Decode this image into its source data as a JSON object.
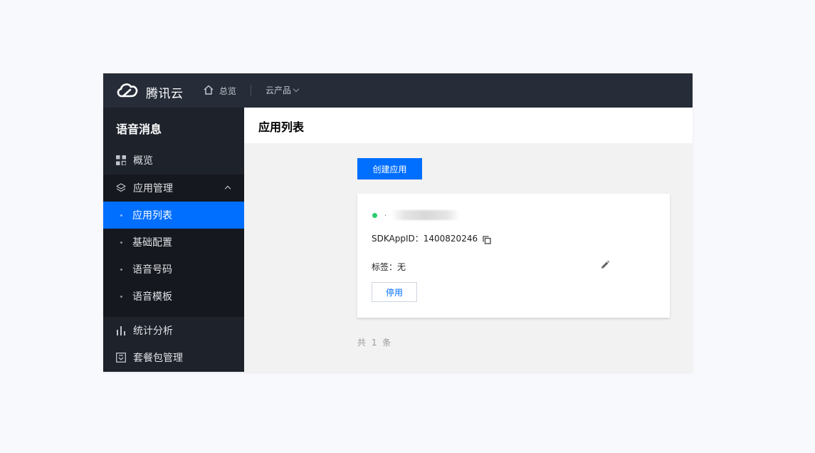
{
  "topbar": {
    "brand": "腾讯云",
    "overview": "总览",
    "products": "云产品"
  },
  "sidebar": {
    "title": "语音消息",
    "items": [
      {
        "label": "概览",
        "icon": "grid-icon"
      },
      {
        "label": "应用管理",
        "icon": "layers-icon",
        "expanded": true,
        "children": [
          "应用列表",
          "基础配置",
          "语音号码",
          "语音模板"
        ],
        "active_child": "应用列表"
      },
      {
        "label": "统计分析",
        "icon": "bar-chart-icon"
      },
      {
        "label": "套餐包管理",
        "icon": "package-icon"
      }
    ]
  },
  "main": {
    "title": "应用列表",
    "create_button": "创建应用",
    "app_card": {
      "status_color": "#29cc6a",
      "sdk_label": "SDKAppID：",
      "sdk_value": "1400820246",
      "tag_label": "标签：",
      "tag_value": "无",
      "disable_button": "停用"
    },
    "total": "共 1 条"
  },
  "colors": {
    "accent": "#006eff",
    "topbar": "#262c38",
    "sidebar": "#1e222b"
  }
}
